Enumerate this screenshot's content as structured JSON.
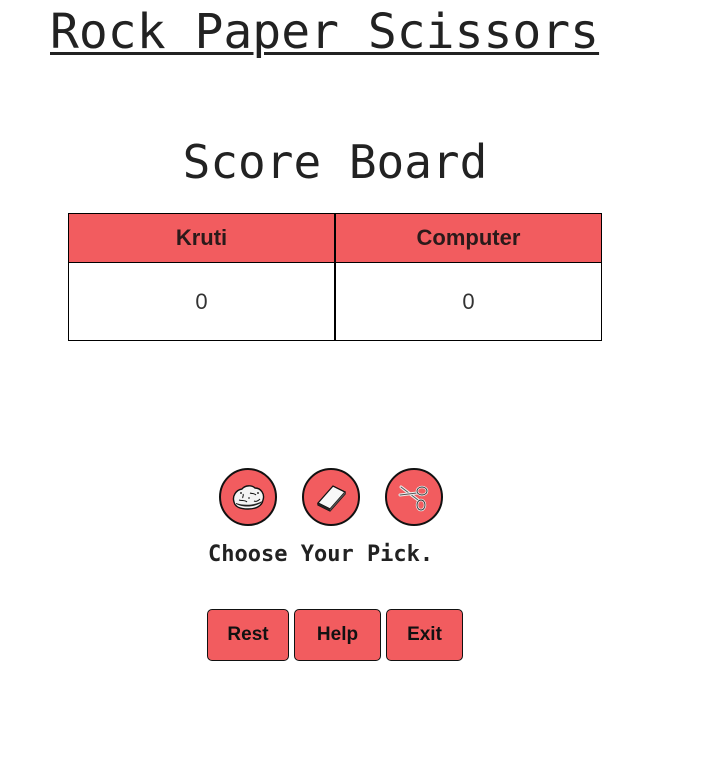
{
  "page": {
    "title": "Rock Paper Scissors",
    "scoreboard_title": "Score Board"
  },
  "scoreboard": {
    "headers": [
      "Kruti",
      "Computer"
    ],
    "scores": [
      "0",
      "0"
    ]
  },
  "choices": [
    {
      "name": "rock",
      "icon": "rock-icon"
    },
    {
      "name": "paper",
      "icon": "paper-icon"
    },
    {
      "name": "scissors",
      "icon": "scissors-icon"
    }
  ],
  "prompt": "Choose Your Pick.",
  "buttons": {
    "rest_label": "Rest",
    "help_label": "Help",
    "exit_label": "Exit"
  },
  "colors": {
    "accent": "#f25c5f",
    "border": "#111111",
    "text": "#222222"
  }
}
